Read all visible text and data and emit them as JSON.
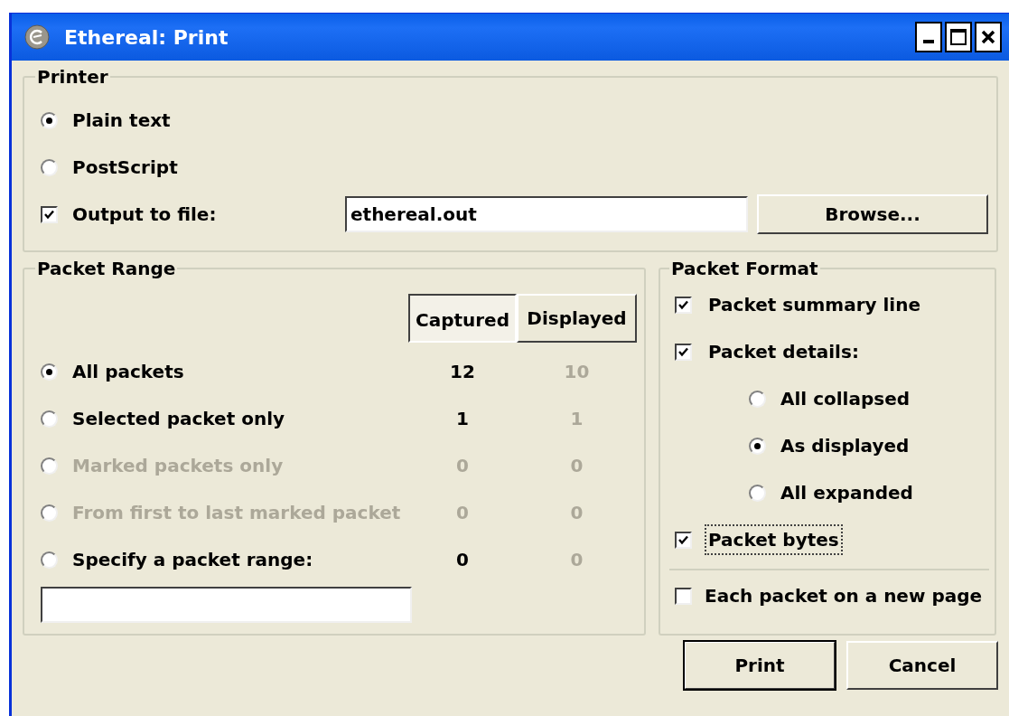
{
  "window": {
    "title": "Ethereal: Print"
  },
  "printer": {
    "title": "Printer",
    "options": [
      {
        "label": "Plain text",
        "selected": true
      },
      {
        "label": "PostScript",
        "selected": false
      }
    ],
    "output_to_file": {
      "label": "Output to file:",
      "checked": true,
      "value": "ethereal.out"
    },
    "browse_button": "Browse..."
  },
  "packet_range": {
    "title": "Packet Range",
    "columns": [
      {
        "label": "Captured",
        "selected": true
      },
      {
        "label": "Displayed",
        "selected": false
      }
    ],
    "rows": [
      {
        "label": "All packets",
        "selected": true,
        "disabled": false,
        "captured": "12",
        "displayed": "10"
      },
      {
        "label": "Selected packet only",
        "selected": false,
        "disabled": false,
        "captured": "1",
        "displayed": "1"
      },
      {
        "label": "Marked packets only",
        "selected": false,
        "disabled": true,
        "captured": "0",
        "displayed": "0"
      },
      {
        "label": "From first to last marked packet",
        "selected": false,
        "disabled": true,
        "captured": "0",
        "displayed": "0"
      },
      {
        "label": "Specify a packet range:",
        "selected": false,
        "disabled": false,
        "captured": "0",
        "displayed": "0"
      }
    ]
  },
  "packet_format": {
    "title": "Packet Format",
    "items": [
      {
        "kind": "checkbox",
        "label": "Packet summary line",
        "checked": true,
        "focused": false
      },
      {
        "kind": "checkbox",
        "label": "Packet details:",
        "checked": true,
        "focused": false,
        "children": [
          {
            "kind": "radio",
            "label": "All collapsed",
            "selected": false
          },
          {
            "kind": "radio",
            "label": "As displayed",
            "selected": true
          },
          {
            "kind": "radio",
            "label": "All expanded",
            "selected": false
          }
        ]
      },
      {
        "kind": "checkbox",
        "label": "Packet bytes",
        "checked": true,
        "focused": true
      }
    ],
    "page_break": {
      "label": "Each packet on a new page",
      "checked": false
    }
  },
  "buttons": [
    {
      "label": "Print",
      "default": true
    },
    {
      "label": "Cancel",
      "default": false
    }
  ]
}
